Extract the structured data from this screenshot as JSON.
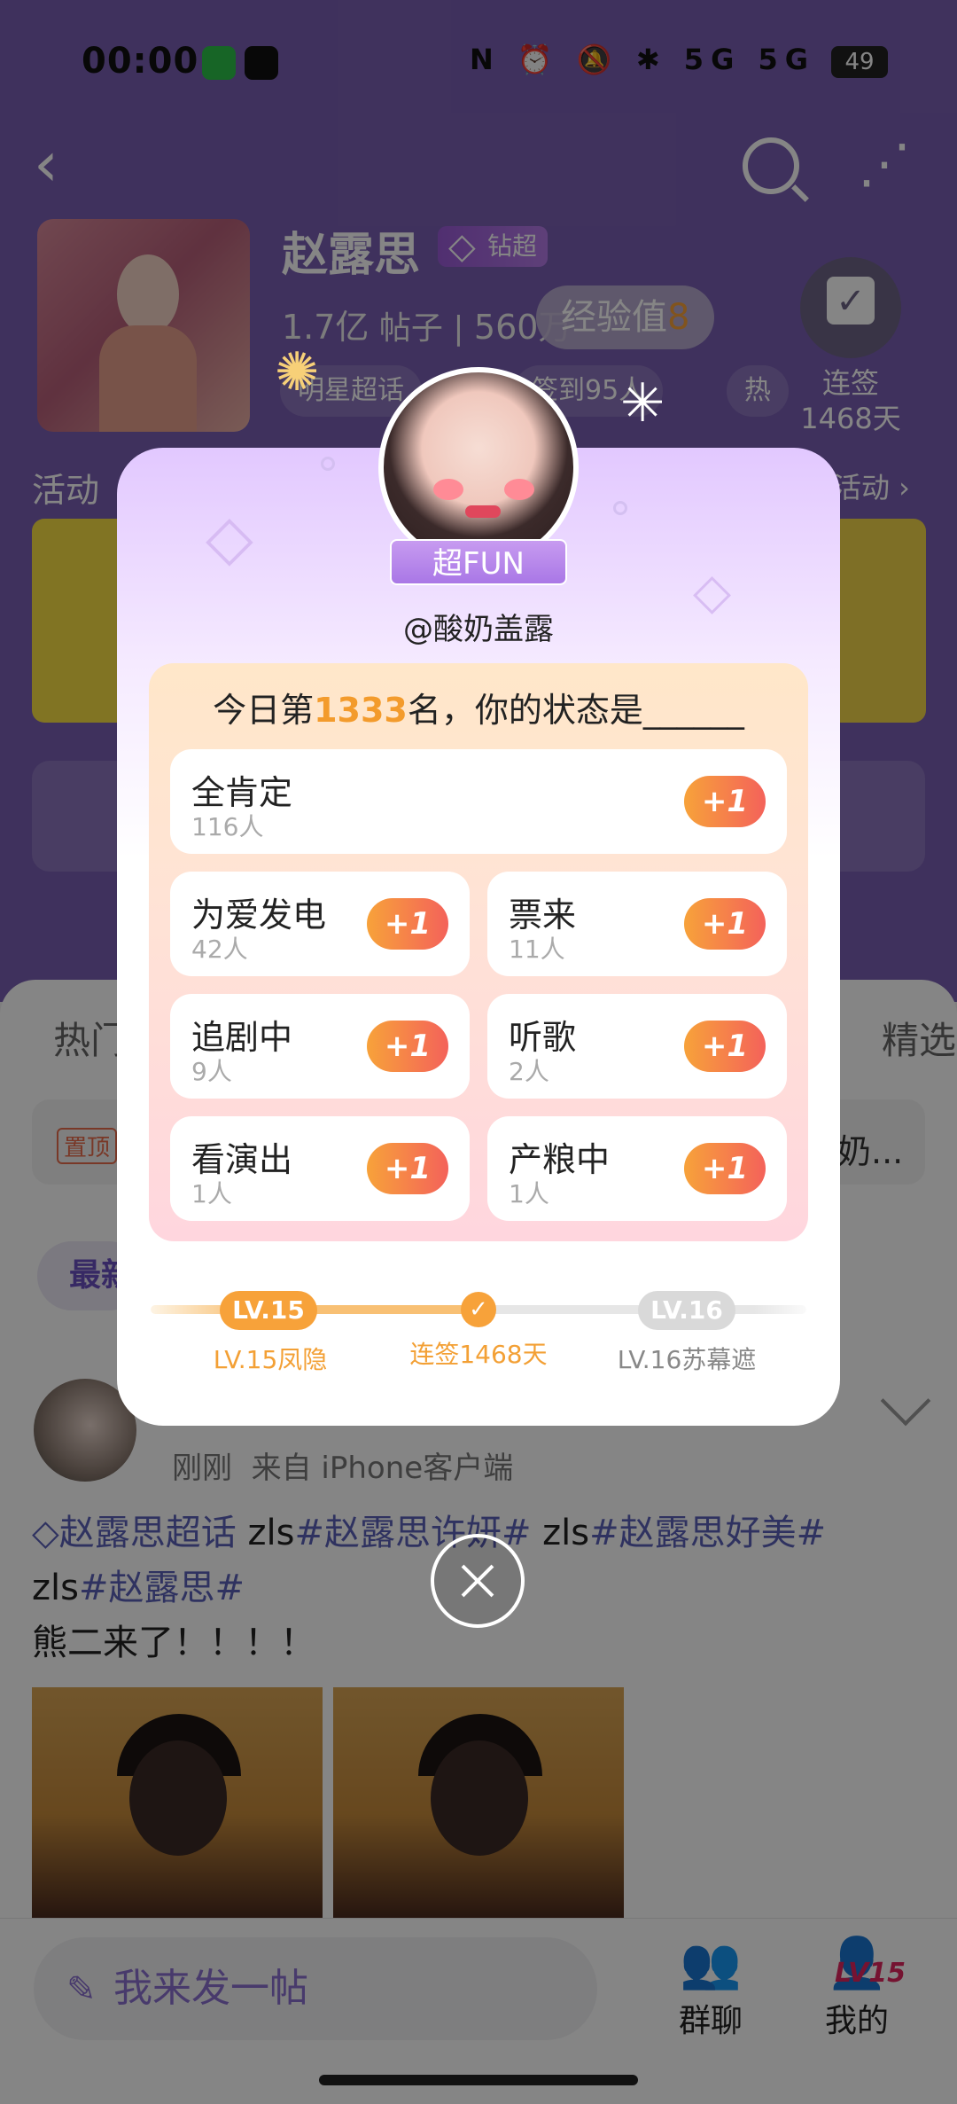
{
  "status_bar": {
    "time": "00:00",
    "icons": "N ⏰ 🔕 ✱ 5G 5G",
    "battery": "49"
  },
  "topic": {
    "name": "赵露思",
    "badge": "钻超",
    "posts_count": "1.7亿",
    "posts_label": "帖子",
    "followers_count": "560万",
    "exp_label": "经验值",
    "exp_value": "8",
    "tag_1": "明星超话",
    "tag_2": "签到95人",
    "tag_3": "热",
    "checkin_label": "连签",
    "checkin_days": "1468天"
  },
  "activity": {
    "title": "活动",
    "more": "活动 ›",
    "post_input_tail": "动 ›"
  },
  "tabs": {
    "hot": "热门",
    "selected": "精选"
  },
  "pinned": {
    "badge": "置顶",
    "tail": "奶..."
  },
  "latest_pill": "最新",
  "post": {
    "meta_time": "刚刚",
    "meta_source": "来自 iPhone客户端",
    "line1_prefix": "◇赵露思超话",
    "line1_mid": " zls",
    "line1_tag1": "#赵露思许妍#",
    "line1_mid2": " zls",
    "line1_tag2": "#赵露思好美#",
    "line2_prefix": "zls",
    "line2_tag": "#赵露思#",
    "line3": "熊二来了！！！！"
  },
  "bottom": {
    "compose_placeholder": "我来发一帖",
    "group_chat": "群聊",
    "mine": "我的",
    "mine_level": "LV15"
  },
  "modal": {
    "badge": "超FUN",
    "handle": "@酸奶盖露",
    "question_prefix": "今日第",
    "question_rank": "1333",
    "question_suffix": "名，你的状态是______",
    "options": [
      {
        "name": "全肯定",
        "count": "116人",
        "action": "+1"
      },
      {
        "name": "为爱发电",
        "count": "42人",
        "action": "+1"
      },
      {
        "name": "票来",
        "count": "11人",
        "action": "+1"
      },
      {
        "name": "追剧中",
        "count": "9人",
        "action": "+1"
      },
      {
        "name": "听歌",
        "count": "2人",
        "action": "+1"
      },
      {
        "name": "看演出",
        "count": "1人",
        "action": "+1"
      },
      {
        "name": "产粮中",
        "count": "1人",
        "action": "+1"
      }
    ],
    "level_current_badge": "LV.15",
    "level_current_name": "LV.15凤隐",
    "checkin_streak": "连签1468天",
    "level_next_badge": "LV.16",
    "level_next_name": "LV.16苏幕遮"
  },
  "colors": {
    "accent_orange": "#f7a23a",
    "accent_purple": "#a977e6",
    "link_blue": "#5b61b8"
  }
}
